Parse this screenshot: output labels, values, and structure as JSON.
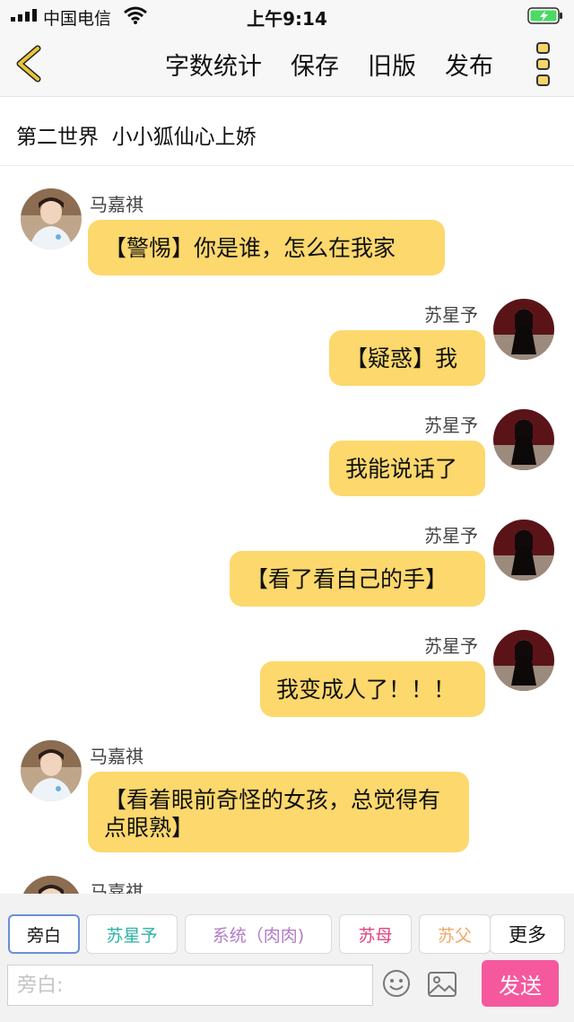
{
  "status_bar": {
    "carrier": "中国电信",
    "time": "上午9:14"
  },
  "nav": {
    "word_count": "字数统计",
    "save": "保存",
    "old_version": "旧版",
    "publish": "发布"
  },
  "story_title": "第二世界  小小狐仙心上娇",
  "messages": [
    {
      "side": "left",
      "speaker": "马嘉祺",
      "text": "【警惕】你是谁，怎么在我家"
    },
    {
      "side": "right",
      "speaker": "苏星予",
      "text": "【疑惑】我"
    },
    {
      "side": "right",
      "speaker": "苏星予",
      "text": "我能说话了"
    },
    {
      "side": "right",
      "speaker": "苏星予",
      "text": "【看了看自己的手】"
    },
    {
      "side": "right",
      "speaker": "苏星予",
      "text": "我变成人了！！！"
    },
    {
      "side": "left",
      "speaker": "马嘉祺",
      "text": "【看着眼前奇怪的女孩，总觉得有点眼熟】"
    },
    {
      "side": "left",
      "speaker": "马嘉祺",
      "text": ""
    }
  ],
  "roles": [
    {
      "label": "旁白",
      "color": "#222222"
    },
    {
      "label": "苏星予",
      "color": "#2bb3a3"
    },
    {
      "label": "系统（肉肉)",
      "color": "#b27cc7"
    },
    {
      "label": "苏母",
      "color": "#e0457f"
    },
    {
      "label": "苏父",
      "color": "#f0a868"
    },
    {
      "label": "更多",
      "color": "#111111"
    }
  ],
  "input": {
    "placeholder": "旁白:"
  },
  "send_label": "发送",
  "colors": {
    "bubble": "#fcd86d",
    "send": "#f5589d",
    "accent_back": "#d8b42a"
  }
}
